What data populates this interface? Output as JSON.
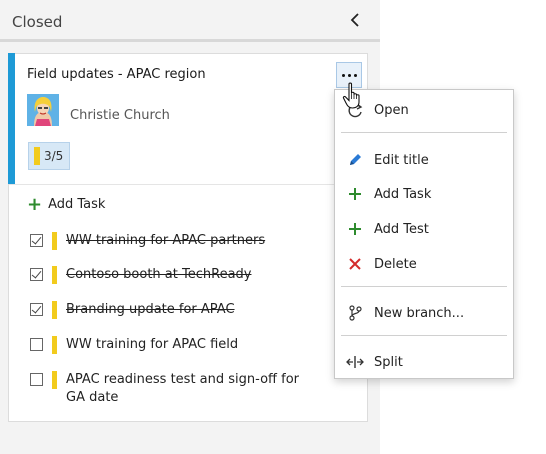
{
  "panel": {
    "title": "Closed",
    "collapse_icon": "chevron-left-icon"
  },
  "card": {
    "title": "Field updates - APAC region",
    "assignee": "Christie Church",
    "progress": "3/5",
    "accent_color": "#1e9ad6",
    "add_task_label": "Add Task",
    "tasks": [
      {
        "title": "WW training for APAC partners",
        "done": true
      },
      {
        "title": "Contoso booth at TechReady",
        "done": true
      },
      {
        "title": "Branding update for APAC",
        "done": true
      },
      {
        "title": "WW training for APAC field",
        "done": false
      },
      {
        "title": "APAC readiness test and sign-off for",
        "title_line2": "GA date",
        "done": false
      }
    ]
  },
  "context_menu": {
    "items": [
      {
        "label": "Open",
        "icon": "open-icon"
      },
      {
        "label": "Edit title",
        "icon": "pencil-icon"
      },
      {
        "label": "Add Task",
        "icon": "plus-icon"
      },
      {
        "label": "Add Test",
        "icon": "plus-icon"
      },
      {
        "label": "Delete",
        "icon": "x-icon"
      },
      {
        "label": "New branch...",
        "icon": "branch-icon"
      },
      {
        "label": "Split",
        "icon": "split-icon"
      }
    ]
  },
  "colors": {
    "accent_blue": "#1e9ad6",
    "task_yellow": "#f2cb1d",
    "add_green": "#2e8b2e",
    "delete_red": "#d42b2b"
  }
}
